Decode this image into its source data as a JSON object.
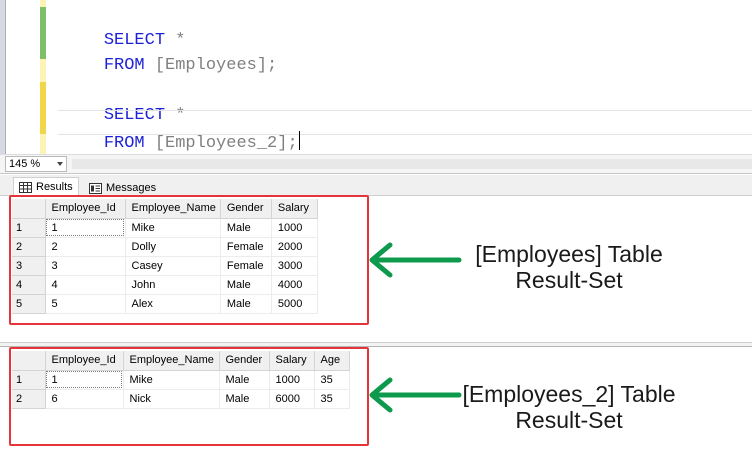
{
  "editor": {
    "lines": [
      {
        "kw": "SELECT",
        "rest": " *"
      },
      {
        "kw": "FROM",
        "rest": " [Employees];"
      },
      {
        "kw": "SELECT",
        "rest": " *"
      },
      {
        "kw": "FROM",
        "rest": " [Employees_2];"
      }
    ]
  },
  "zoom": {
    "value": "145 %"
  },
  "tabs": {
    "results": "Results",
    "messages": "Messages"
  },
  "grid1": {
    "columns": [
      "Employee_Id",
      "Employee_Name",
      "Gender",
      "Salary"
    ],
    "rows": [
      {
        "n": "1",
        "cells": [
          "1",
          "Mike",
          "Male",
          "1000"
        ]
      },
      {
        "n": "2",
        "cells": [
          "2",
          "Dolly",
          "Female",
          "2000"
        ]
      },
      {
        "n": "3",
        "cells": [
          "3",
          "Casey",
          "Female",
          "3000"
        ]
      },
      {
        "n": "4",
        "cells": [
          "4",
          "John",
          "Male",
          "4000"
        ]
      },
      {
        "n": "5",
        "cells": [
          "5",
          "Alex",
          "Male",
          "5000"
        ]
      }
    ]
  },
  "grid2": {
    "columns": [
      "Employee_Id",
      "Employee_Name",
      "Gender",
      "Salary",
      "Age"
    ],
    "rows": [
      {
        "n": "1",
        "cells": [
          "1",
          "Mike",
          "Male",
          "1000",
          "35"
        ]
      },
      {
        "n": "2",
        "cells": [
          "6",
          "Nick",
          "Male",
          "6000",
          "35"
        ]
      }
    ]
  },
  "annotations": {
    "first": {
      "line1": "[Employees] Table",
      "line2": "Result-Set"
    },
    "second": {
      "line1": "[Employees_2] Table",
      "line2": "Result-Set"
    }
  },
  "colors": {
    "keyword": "#1d22d6",
    "highlight_box": "#e5343a",
    "arrow": "#0e9a4c"
  }
}
